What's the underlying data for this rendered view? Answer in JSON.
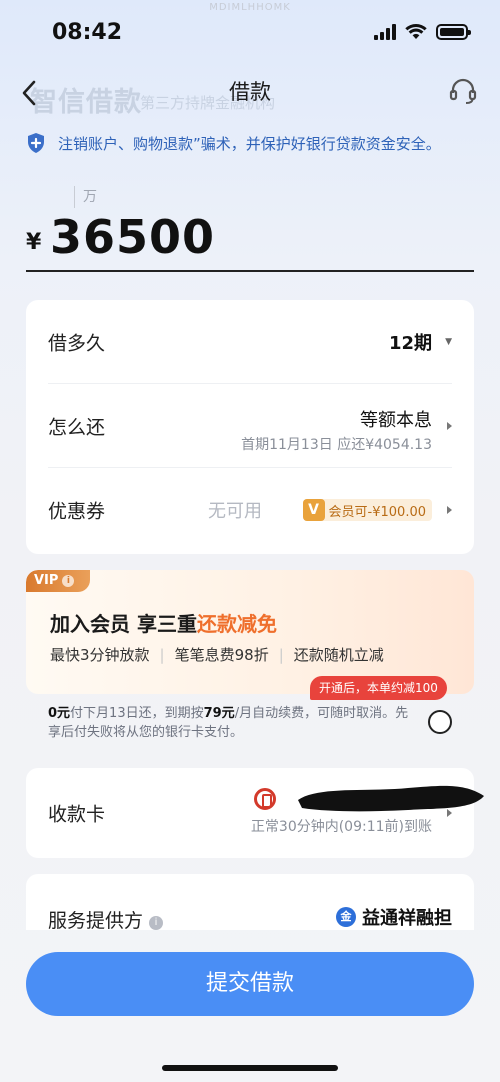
{
  "status_bar": {
    "time": "08:42",
    "watermark": "MDIMLHHOMK",
    "icons": [
      "signal-icon",
      "wifi-icon",
      "battery-icon"
    ]
  },
  "nav": {
    "title": "借款",
    "brand": "智信借款",
    "brand_sub": "第三方持牌金融机构",
    "back_icon": "chevron-left-icon",
    "service_icon": "headset-icon"
  },
  "notice": {
    "text": "注销账户、购物退款”骗术，并保护好银行贷款资金安全。",
    "icon": "shield-plus-icon"
  },
  "amount": {
    "unit_hint": "万",
    "currency": "¥",
    "value": "36500"
  },
  "loan_details": {
    "term": {
      "label": "借多久",
      "value": "12期"
    },
    "repayment": {
      "label": "怎么还",
      "value": "等额本息",
      "sub": "首期11月13日 应还¥4054.13"
    },
    "coupon": {
      "label": "优惠券",
      "none_text": "无可用",
      "vip_letter": "V",
      "vip_text": "会员可-¥100.00"
    }
  },
  "membership": {
    "badge": "VIP",
    "title_prefix": "加入会员 享三重",
    "title_highlight": "还款减免",
    "perks": [
      "最快3分钟放款",
      "笔笔息费98折",
      "还款随机立减"
    ],
    "promo": "开通后，本单约减100",
    "terms_amount_first": "0元",
    "terms_part1": "付下月13日还，到期按",
    "terms_amount_second": "79元",
    "terms_part2": "/月自动续费，可随时取消。先享后付失败将从您的银行卡支付。",
    "accent_color": "#ef6f2c"
  },
  "bank_card": {
    "label": "收款卡",
    "sub": "正常30分钟内(09:11前)到账"
  },
  "provider": {
    "label": "服务提供方",
    "value": "益通祥融担",
    "icon_text": "金"
  },
  "submit": {
    "label": "提交借款",
    "color": "#4a8ef5"
  }
}
